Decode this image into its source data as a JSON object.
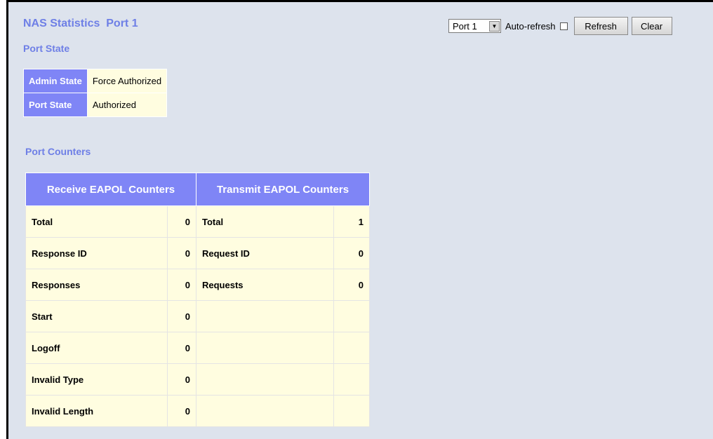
{
  "page_title": "NAS Statistics  Port 1",
  "toolbar": {
    "port_select_value": "Port 1",
    "auto_refresh_label": "Auto-refresh",
    "refresh_label": "Refresh",
    "clear_label": "Clear"
  },
  "port_state": {
    "section_title": "Port State",
    "rows": [
      {
        "label": "Admin State",
        "value": "Force Authorized"
      },
      {
        "label": "Port State",
        "value": "Authorized"
      }
    ]
  },
  "port_counters": {
    "section_title": "Port Counters",
    "receive_header": "Receive EAPOL Counters",
    "transmit_header": "Transmit EAPOL Counters",
    "rows": [
      {
        "rx_label": "Total",
        "rx_value": "0",
        "tx_label": "Total",
        "tx_value": "1"
      },
      {
        "rx_label": "Response ID",
        "rx_value": "0",
        "tx_label": "Request ID",
        "tx_value": "0"
      },
      {
        "rx_label": "Responses",
        "rx_value": "0",
        "tx_label": "Requests",
        "tx_value": "0"
      },
      {
        "rx_label": "Start",
        "rx_value": "0",
        "tx_label": "",
        "tx_value": ""
      },
      {
        "rx_label": "Logoff",
        "rx_value": "0",
        "tx_label": "",
        "tx_value": ""
      },
      {
        "rx_label": "Invalid Type",
        "rx_value": "0",
        "tx_label": "",
        "tx_value": ""
      },
      {
        "rx_label": "Invalid Length",
        "rx_value": "0",
        "tx_label": "",
        "tx_value": ""
      }
    ]
  }
}
